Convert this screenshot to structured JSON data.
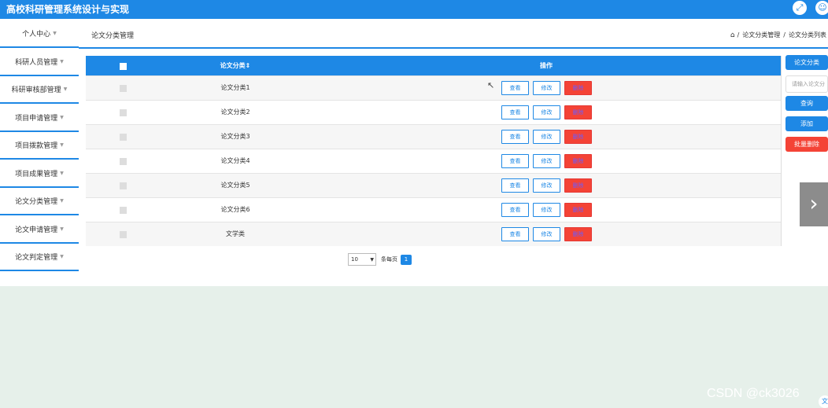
{
  "header": {
    "title": "高校科研管理系统设计与实现",
    "fullscreen_icon": "fullscreen-icon",
    "user_icon": "user-icon"
  },
  "sidebar": {
    "items": [
      {
        "label": "个人中心"
      },
      {
        "label": "科研人员管理"
      },
      {
        "label": "科研审核部管理"
      },
      {
        "label": "项目申请管理"
      },
      {
        "label": "项目拨款管理"
      },
      {
        "label": "项目成果管理"
      },
      {
        "label": "论文分类管理"
      },
      {
        "label": "论文申请管理"
      },
      {
        "label": "论文判定管理"
      }
    ],
    "caret": "▼"
  },
  "page": {
    "title": "论文分类管理",
    "breadcrumb": [
      "论文分类管理",
      "论文分类列表"
    ],
    "breadcrumb_sep": "/"
  },
  "table": {
    "columns": {
      "name": "论文分类",
      "ops": "操作"
    },
    "sort_icon": "⇕",
    "rows": [
      {
        "name": "论文分类1"
      },
      {
        "name": "论文分类2"
      },
      {
        "name": "论文分类3"
      },
      {
        "name": "论文分类4"
      },
      {
        "name": "论文分类5"
      },
      {
        "name": "论文分类6"
      },
      {
        "name": "文学类"
      }
    ],
    "actions": {
      "view": "查看",
      "edit": "修改",
      "delete": "删除"
    }
  },
  "pager": {
    "page_size": "10",
    "per_page_label": "条每页",
    "current_page": "1"
  },
  "right_panel": {
    "field_label": "论文分类",
    "search_placeholder": "请输入论文分",
    "search_button": "查询",
    "add_button": "添加",
    "batch_delete_button": "批量删除"
  },
  "watermark": "CSDN @ck3026",
  "colors": {
    "primary": "#1e88e5",
    "danger": "#f44336",
    "background": "#e6f0ea"
  }
}
